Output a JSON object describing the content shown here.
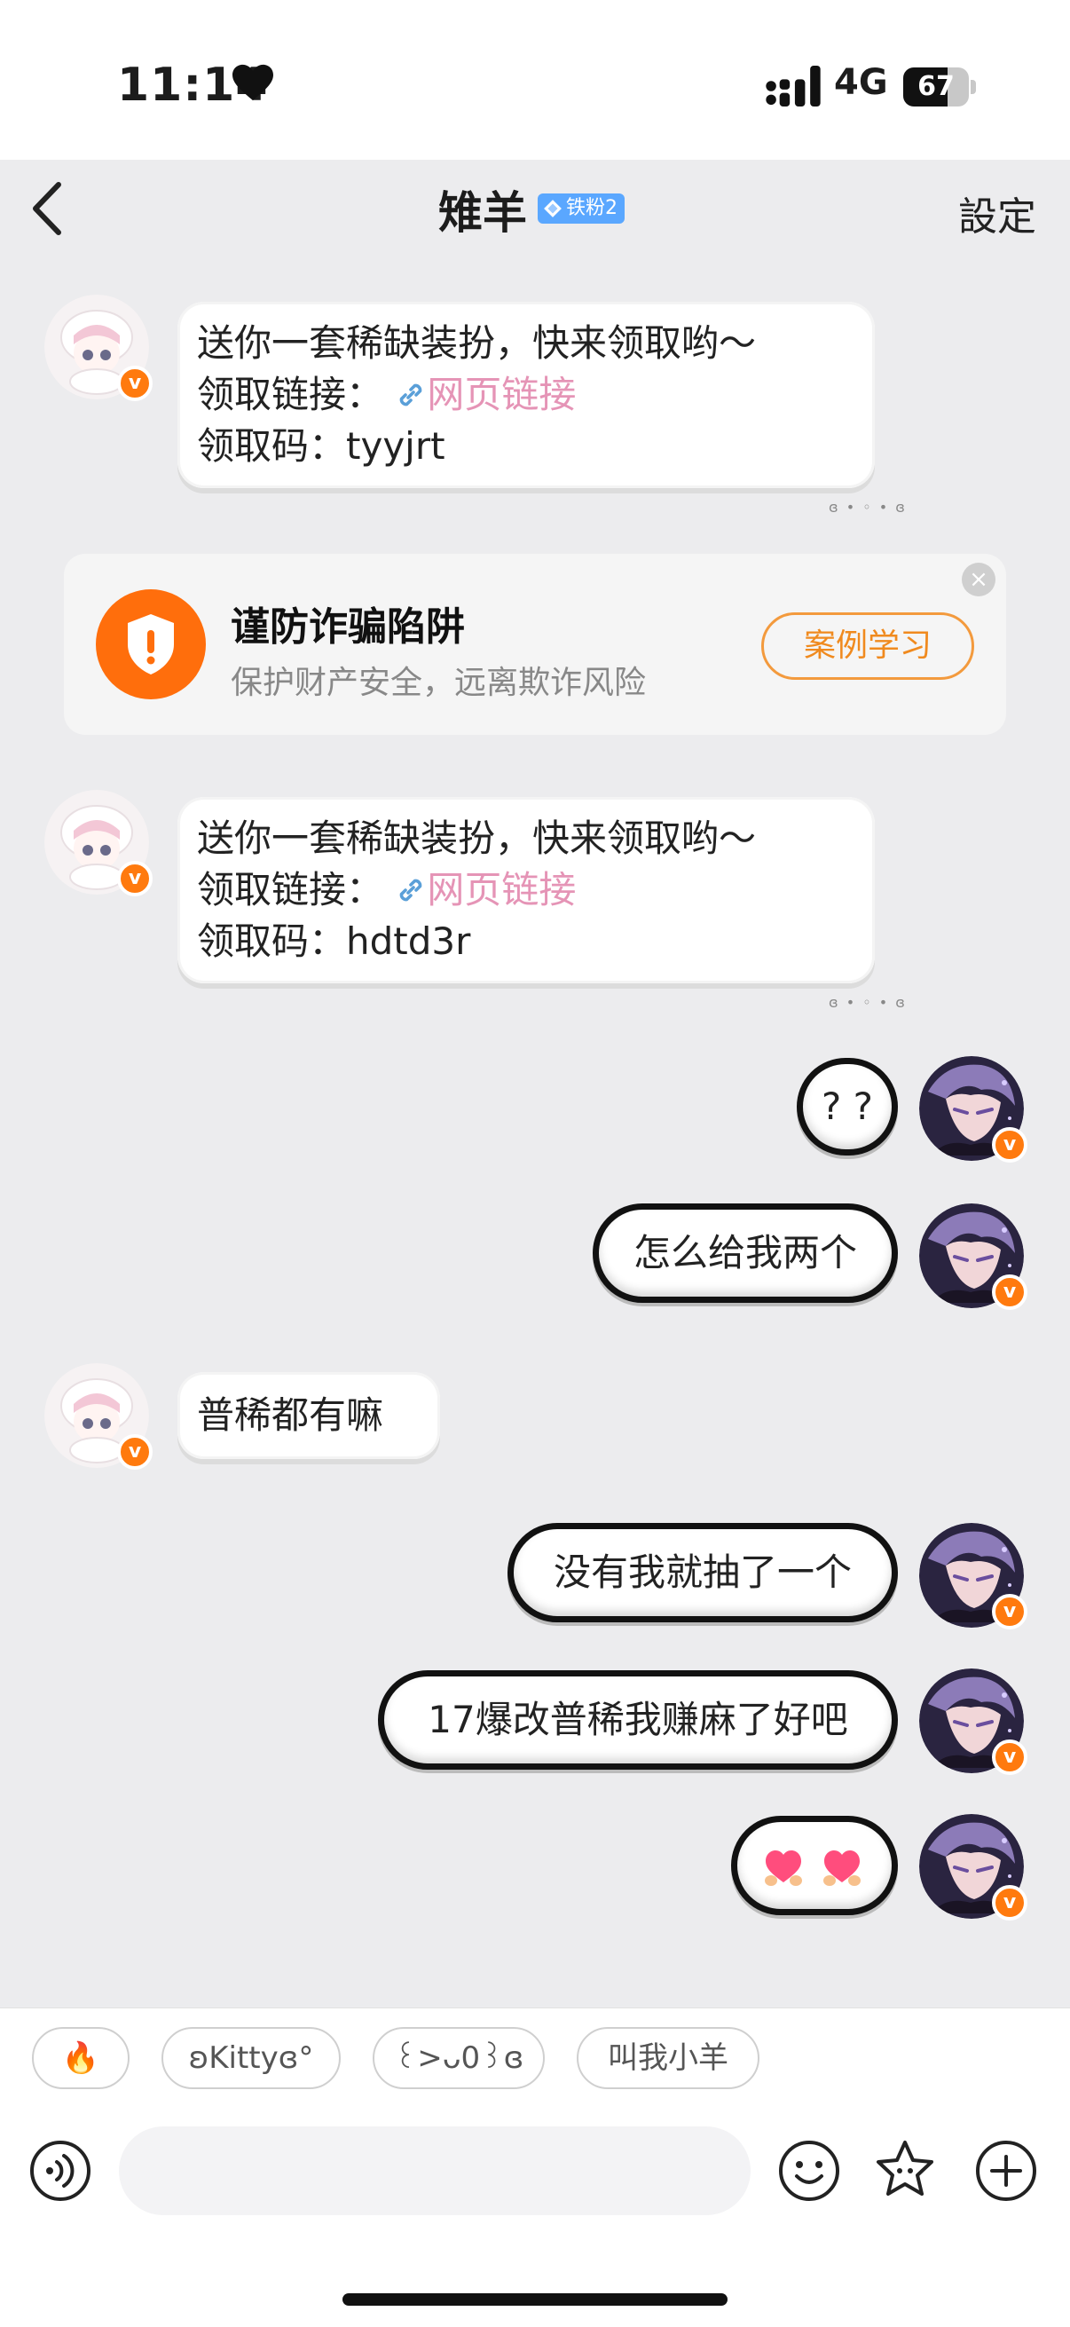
{
  "status_bar": {
    "time": "11:14",
    "network": "4G",
    "battery_level": "67",
    "icons": [
      "heart-icon",
      "signal-icon",
      "battery-icon"
    ]
  },
  "header": {
    "back_icon": "chevron-left-icon",
    "title": "雉羊",
    "fan_badge": "铁粉2",
    "settings": "設定"
  },
  "messages": [
    {
      "direction": "incoming",
      "line1": "送你一套稀缺装扮，快来领取哟～",
      "line2_label": "领取链接：",
      "line2_link": "网页链接",
      "line3": "领取码：tyyjrt"
    },
    {
      "direction": "incoming",
      "line1": "送你一套稀缺装扮，快来领取哟～",
      "line2_label": "领取链接：",
      "line2_link": "网页链接",
      "line3": "领取码：hdtd3r"
    },
    {
      "direction": "outgoing",
      "text": "? ?"
    },
    {
      "direction": "outgoing",
      "text": "怎么给我两个"
    },
    {
      "direction": "incoming",
      "text": "普稀都有嘛"
    },
    {
      "direction": "outgoing",
      "text": "没有我就抽了一个"
    },
    {
      "direction": "outgoing",
      "text": "17爆改普稀我赚麻了好吧"
    },
    {
      "direction": "outgoing",
      "text": "",
      "emoji": [
        "heart-hands-emoji",
        "heart-hands-emoji"
      ]
    }
  ],
  "bubble_tail": "ɞ • ◦ • ɞ",
  "warning": {
    "title": "谨防诈骗陷阱",
    "subtitle": "保护财产安全，远离欺诈风险",
    "button": "案例学习",
    "icon": "shield-alert-icon",
    "accent": "#ff6e0c"
  },
  "quick_replies": [
    "🔥",
    "ʚKittyɞ°",
    "꒰>ᴗ0꒱ɞ",
    "叫我小羊"
  ],
  "input_bar": {
    "voice_icon": "voice-icon",
    "placeholder": "",
    "emoji_icon": "smiley-icon",
    "sticker_icon": "star-sticker-icon",
    "plus_icon": "plus-circle-icon"
  }
}
